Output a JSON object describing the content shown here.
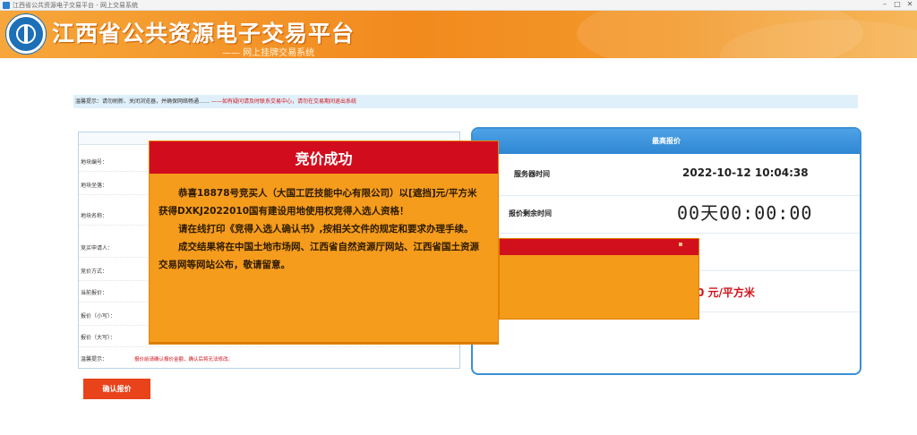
{
  "window": {
    "title": "江西省公共资源电子交易平台 - 网上交易系统",
    "controls": [
      "–",
      "□",
      "✕"
    ]
  },
  "header": {
    "site_title": "江西省公共资源电子交易平台",
    "site_subtitle": "—— 网上挂牌交易系统"
  },
  "notice": {
    "text": "温馨提示：请勿刷新、关闭浏览器，并确保网络畅通……",
    "red_text": "——如有疑问请及时联系交易中心，请勿在交易期间退出系统"
  },
  "left_panel": {
    "rows": [
      {
        "label": "地块编号：",
        "value": ""
      },
      {
        "label": "地块坐落：",
        "value": ""
      },
      {
        "label": "地块名称：",
        "value": ""
      },
      {
        "label": "竞买申请人：",
        "value": ""
      },
      {
        "label": "竞价方式：",
        "value": ""
      },
      {
        "label": "当前报价：",
        "value": ""
      },
      {
        "label": "报价（小写）：",
        "value": ""
      },
      {
        "label": "报价（大写）：",
        "value": ""
      },
      {
        "label": "温馨提示：",
        "value": "报价前请确认报价金额，确认后将无法修改。"
      }
    ]
  },
  "right_panel": {
    "title": "最高报价",
    "server_time_label": "服务器时间",
    "server_time": "2022-10-12 10:04:38",
    "remaining_label": "报价剩余时间",
    "countdown": "00天00:00:00",
    "paren_value": ")",
    "price_value": "0 元/平方米"
  },
  "popup": {
    "title": "竞价成功",
    "paragraphs": [
      "恭喜18878号竞买人（大国工匠技能中心有限公司）以[遮挡]元/平方米获得DXKJ2022010国有建设用地使用权竞得入选人资格！",
      "请在线打印《竞得入选人确认书》,按相关文件的规定和要求办理手续。",
      "成交结果将在中国土地市场网、江西省自然资源厅网站、江西省国土资源交易网等网站公布，敬请留意。"
    ]
  },
  "submit_button": {
    "label": "确认报价"
  },
  "colors": {
    "banner_orange": "#f28a1e",
    "popup_red": "#d10d1d",
    "popup_orange": "#f59c1d",
    "panel_blue": "#3b8fd6",
    "price_red": "#d0111b"
  }
}
